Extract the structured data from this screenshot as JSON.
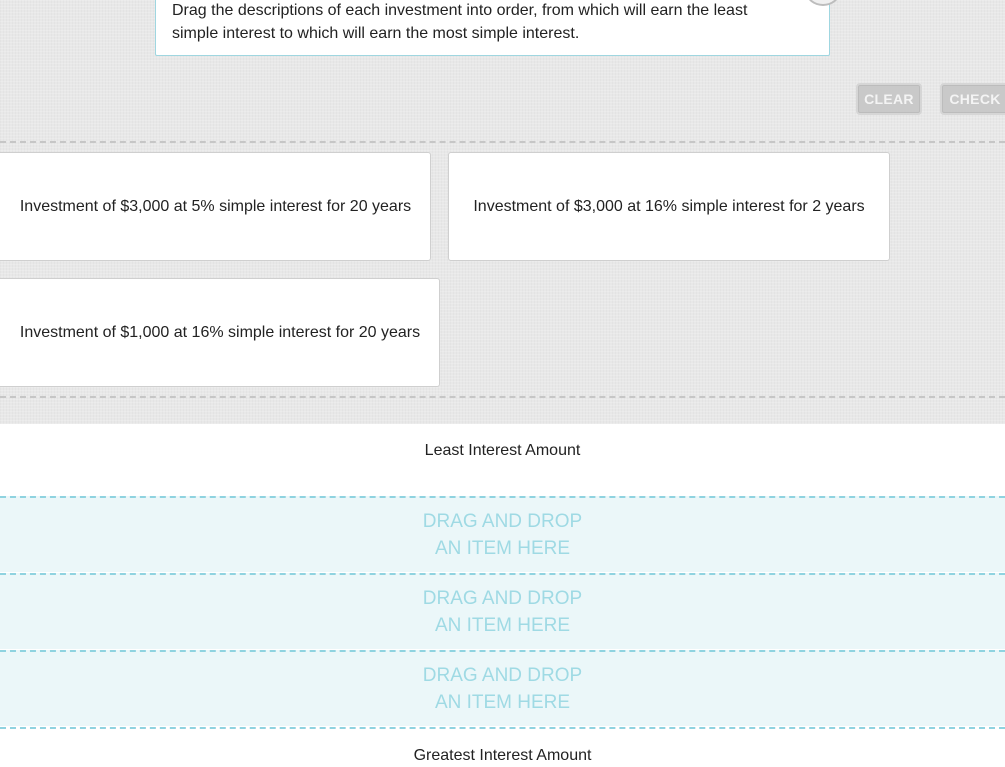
{
  "instruction": {
    "line1": "Drag the descriptions of each investment into order, from which will earn the least",
    "line2": "simple interest to which will earn the most simple interest."
  },
  "toolbar": {
    "clear_label": "CLEAR",
    "check_label": "CHECK"
  },
  "cards": [
    {
      "label": "Investment of $3,000 at 5% simple interest for 20 years"
    },
    {
      "label": "Investment of $3,000 at 16% simple interest for 2 years"
    },
    {
      "label": "Investment of $1,000 at 16% simple interest for 20 years"
    }
  ],
  "ordering": {
    "least_label": "Least Interest Amount",
    "greatest_label": "Greatest Interest Amount",
    "drop_zones": [
      {
        "line1": "DRAG AND DROP",
        "line2": "AN ITEM HERE"
      },
      {
        "line1": "DRAG AND DROP",
        "line2": "AN ITEM HERE"
      },
      {
        "line1": "DRAG AND DROP",
        "line2": "AN ITEM HERE"
      }
    ]
  },
  "colors": {
    "accent": "#8fd3e0",
    "drop_zone_bg": "#ebf7f9",
    "drop_zone_text": "#9fdae4",
    "button_bg": "#c9c9c9"
  }
}
